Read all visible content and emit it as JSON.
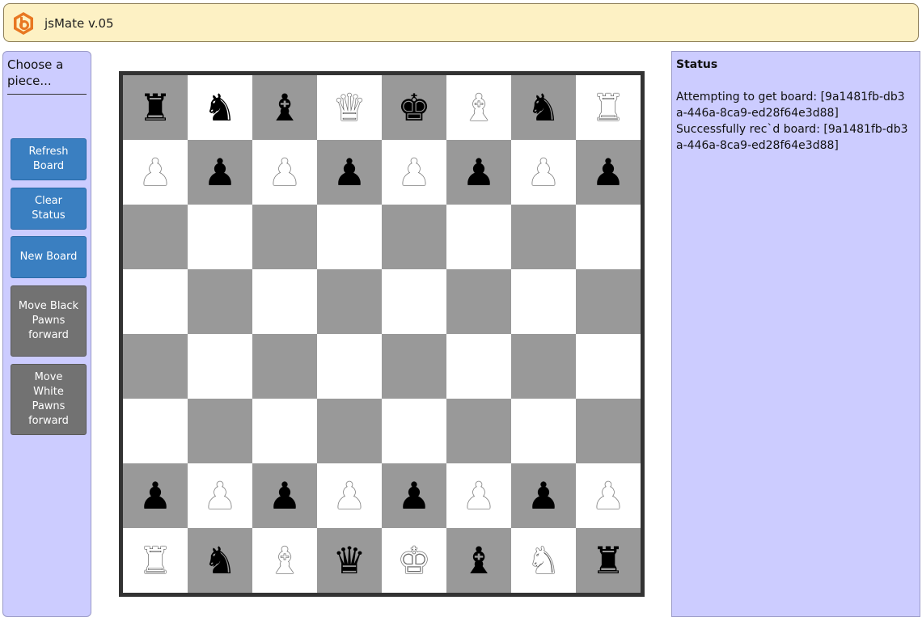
{
  "header": {
    "title": "jsMate v.05",
    "logo_icon": "hexagon-logo-icon",
    "logo_color": "#e87722"
  },
  "sidebar": {
    "prompt": "Choose a piece...",
    "buttons": [
      {
        "label": "Refresh Board",
        "style": "blue"
      },
      {
        "label": "Clear Status",
        "style": "blue"
      },
      {
        "label": "New Board",
        "style": "blue"
      },
      {
        "label": "Move Black Pawns forward",
        "style": "gray"
      },
      {
        "label": "Move White Pawns forward",
        "style": "gray"
      }
    ]
  },
  "board": {
    "colors": {
      "light": "#ffffff",
      "dark": "#999999"
    },
    "rows": [
      [
        "br",
        "bn",
        "bb",
        "wq",
        "bk",
        "wb",
        "bn",
        "wr"
      ],
      [
        "wp",
        "bp",
        "wp",
        "bp",
        "wp",
        "bp",
        "wp",
        "bp"
      ],
      [
        "",
        "",
        "",
        "",
        "",
        "",
        "",
        ""
      ],
      [
        "",
        "",
        "",
        "",
        "",
        "",
        "",
        ""
      ],
      [
        "",
        "",
        "",
        "",
        "",
        "",
        "",
        ""
      ],
      [
        "",
        "",
        "",
        "",
        "",
        "",
        "",
        ""
      ],
      [
        "bp",
        "wp",
        "bp",
        "wp",
        "bp",
        "wp",
        "bp",
        "wp"
      ],
      [
        "wr",
        "bn",
        "wb",
        "bq",
        "wk",
        "bb",
        "wn",
        "br"
      ]
    ]
  },
  "status": {
    "title": "Status",
    "lines": [
      "Attempting to get board: [9a1481fb-db3a-446a-8ca9-ed28f64e3d88]",
      "Successfully rec`d board: [9a1481fb-db3a-446a-8ca9-ed28f64e3d88]"
    ]
  }
}
